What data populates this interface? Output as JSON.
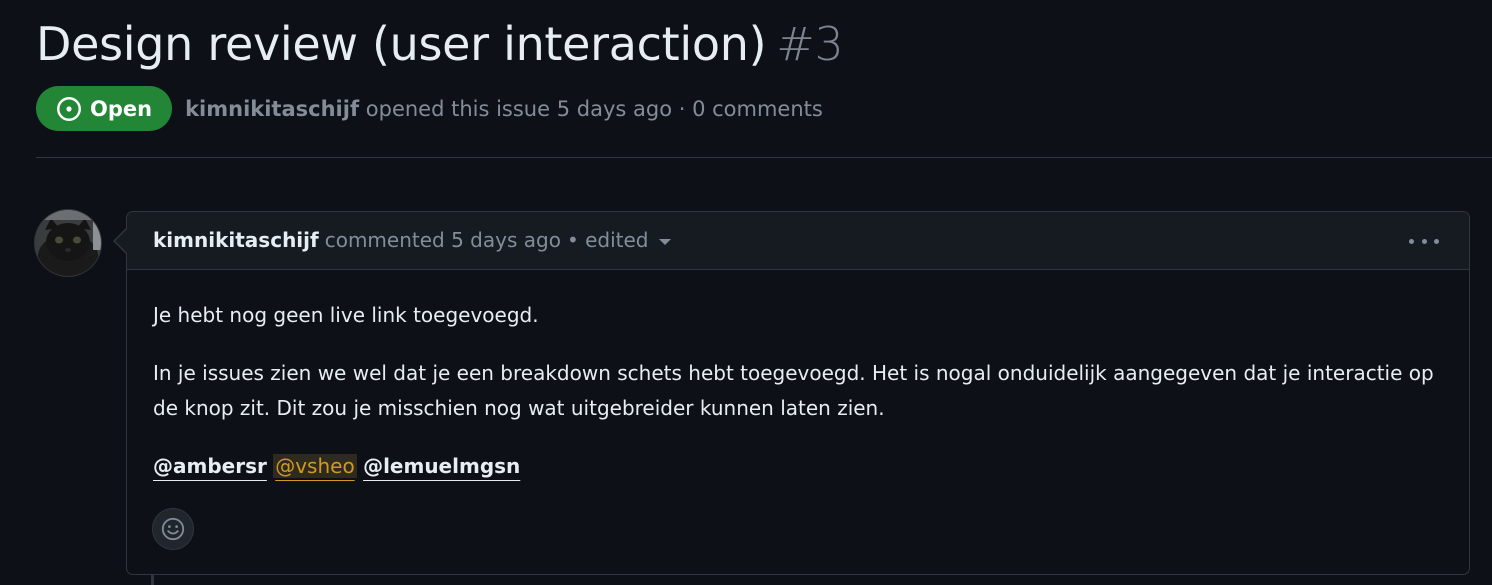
{
  "issue": {
    "title": "Design review (user interaction)",
    "number": "#3",
    "state": "Open",
    "author": "kimnikitaschijf",
    "opened_text": "opened this issue 5 days ago · 0 comments"
  },
  "comment": {
    "author": "kimnikitaschijf",
    "meta": "commented 5 days ago",
    "edited": "• edited",
    "paragraphs": [
      "Je hebt nog geen live link toegevoegd.",
      "In je issues zien we wel dat je een breakdown schets hebt toegevoegd. Het is nogal onduidelijk aangegeven dat je interactie op de knop zit. Dit zou je misschien nog wat uitgebreider kunnen laten zien."
    ],
    "mentions": [
      "@ambersr",
      "@vsheo",
      "@lemuelmgsn"
    ]
  },
  "icons": {
    "state": "issue-opened-icon",
    "menu": "kebab-horizontal-icon",
    "reaction": "smiley-icon",
    "caret": "triangle-down-icon"
  },
  "colors": {
    "background": "#0d1117",
    "open_badge": "#238636",
    "border": "#30363d",
    "muted": "#848d97",
    "highlight_mention": "#d29922"
  }
}
